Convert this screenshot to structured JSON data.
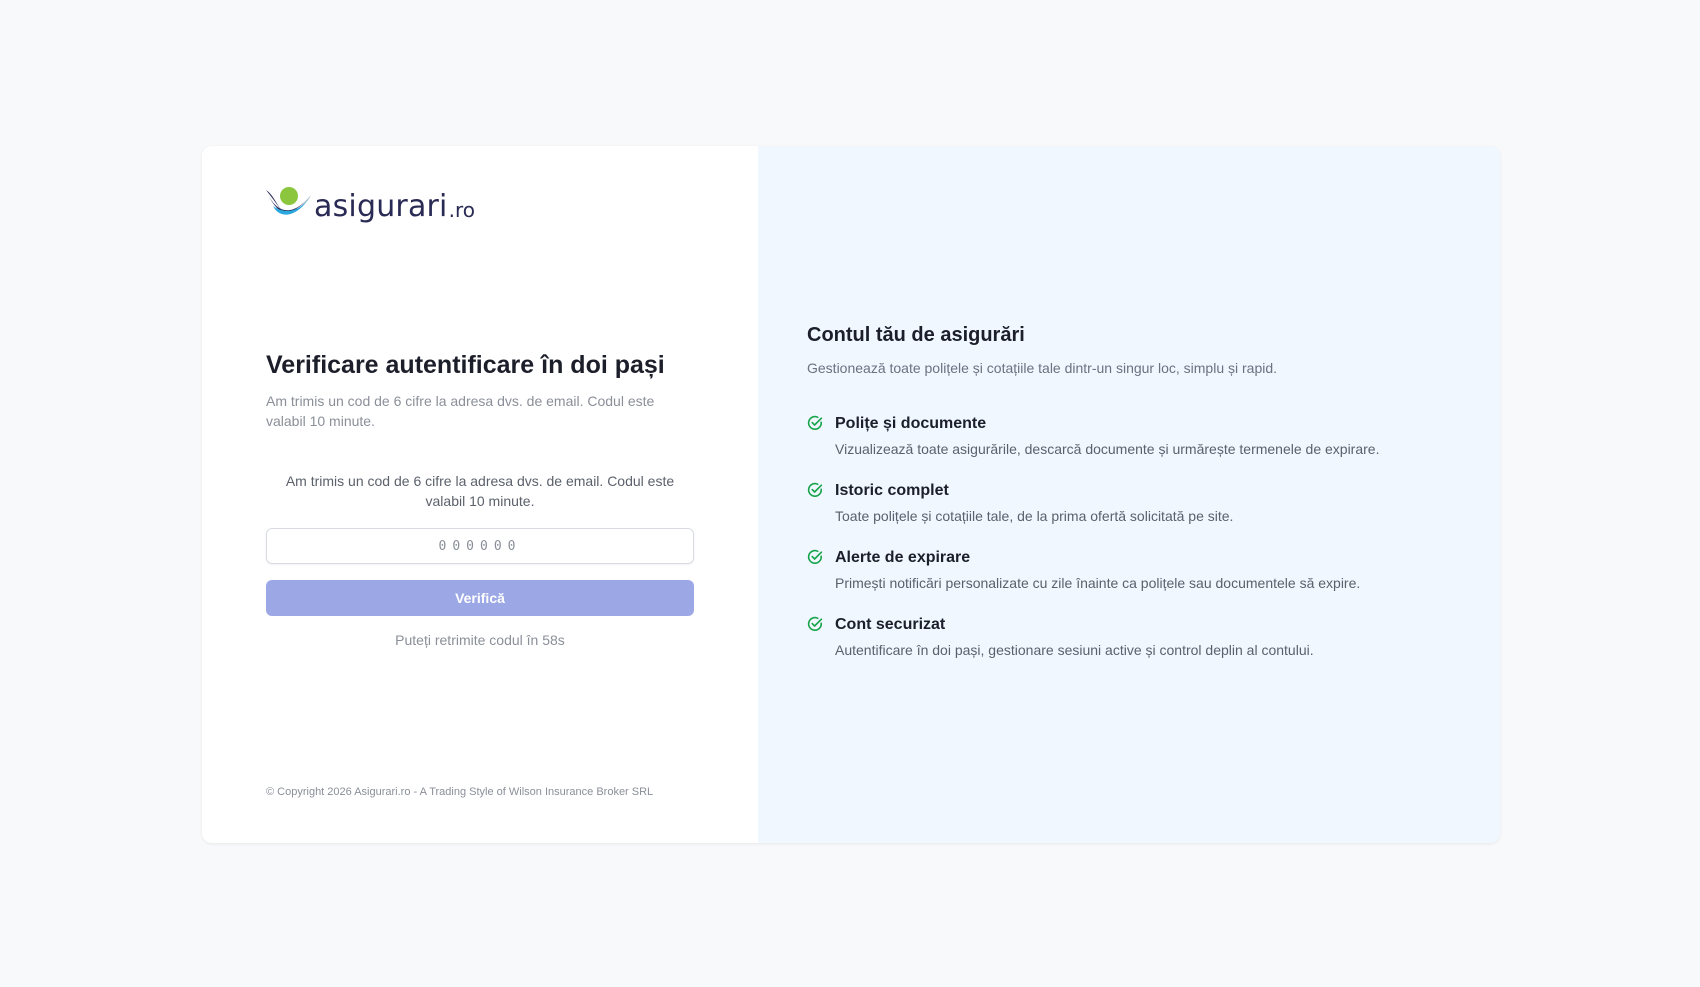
{
  "brand": {
    "name": "asigurari",
    "tld": ".ro",
    "colors": {
      "dark": "#2a2b55",
      "green": "#8cc63f",
      "blue": "#29a8e0"
    }
  },
  "verification": {
    "title": "Verificare autentificare în doi pași",
    "subtitle": "Am trimis un cod de 6 cifre la adresa dvs. de email. Codul este valabil 10 minute.",
    "info": "Am trimis un cod de 6 cifre la adresa dvs. de email. Codul este valabil 10 minute.",
    "code_placeholder": "000000",
    "code_value": "",
    "verify_label": "Verifică",
    "resend_text": "Puteți retrimite codul în 58s"
  },
  "footer": {
    "copyright": "© Copyright 2026 Asigurari.ro - A Trading Style of Wilson Insurance Broker SRL"
  },
  "promo": {
    "title": "Contul tău de asigurări",
    "subtitle": "Gestionează toate polițele și cotațiile tale dintr-un singur loc, simplu și rapid.",
    "features": [
      {
        "icon": "check-circle-icon",
        "title": "Polițe și documente",
        "description": "Vizualizează toate asigurările, descarcă documente și urmărește termenele de expirare."
      },
      {
        "icon": "check-circle-icon",
        "title": "Istoric complet",
        "description": "Toate polițele și cotațiile tale, de la prima ofertă solicitată pe site."
      },
      {
        "icon": "check-circle-icon",
        "title": "Alerte de expirare",
        "description": "Primești notificări personalizate cu zile înainte ca polițele sau documentele să expire."
      },
      {
        "icon": "check-circle-icon",
        "title": "Cont securizat",
        "description": "Autentificare în doi pași, gestionare sesiuni active și control deplin al contului."
      }
    ],
    "accent_color": "#16a34a"
  },
  "colors": {
    "page_background": "#f8f9fa",
    "right_panel": "#f0f7ff",
    "button_disabled": "#9ca7e5"
  }
}
